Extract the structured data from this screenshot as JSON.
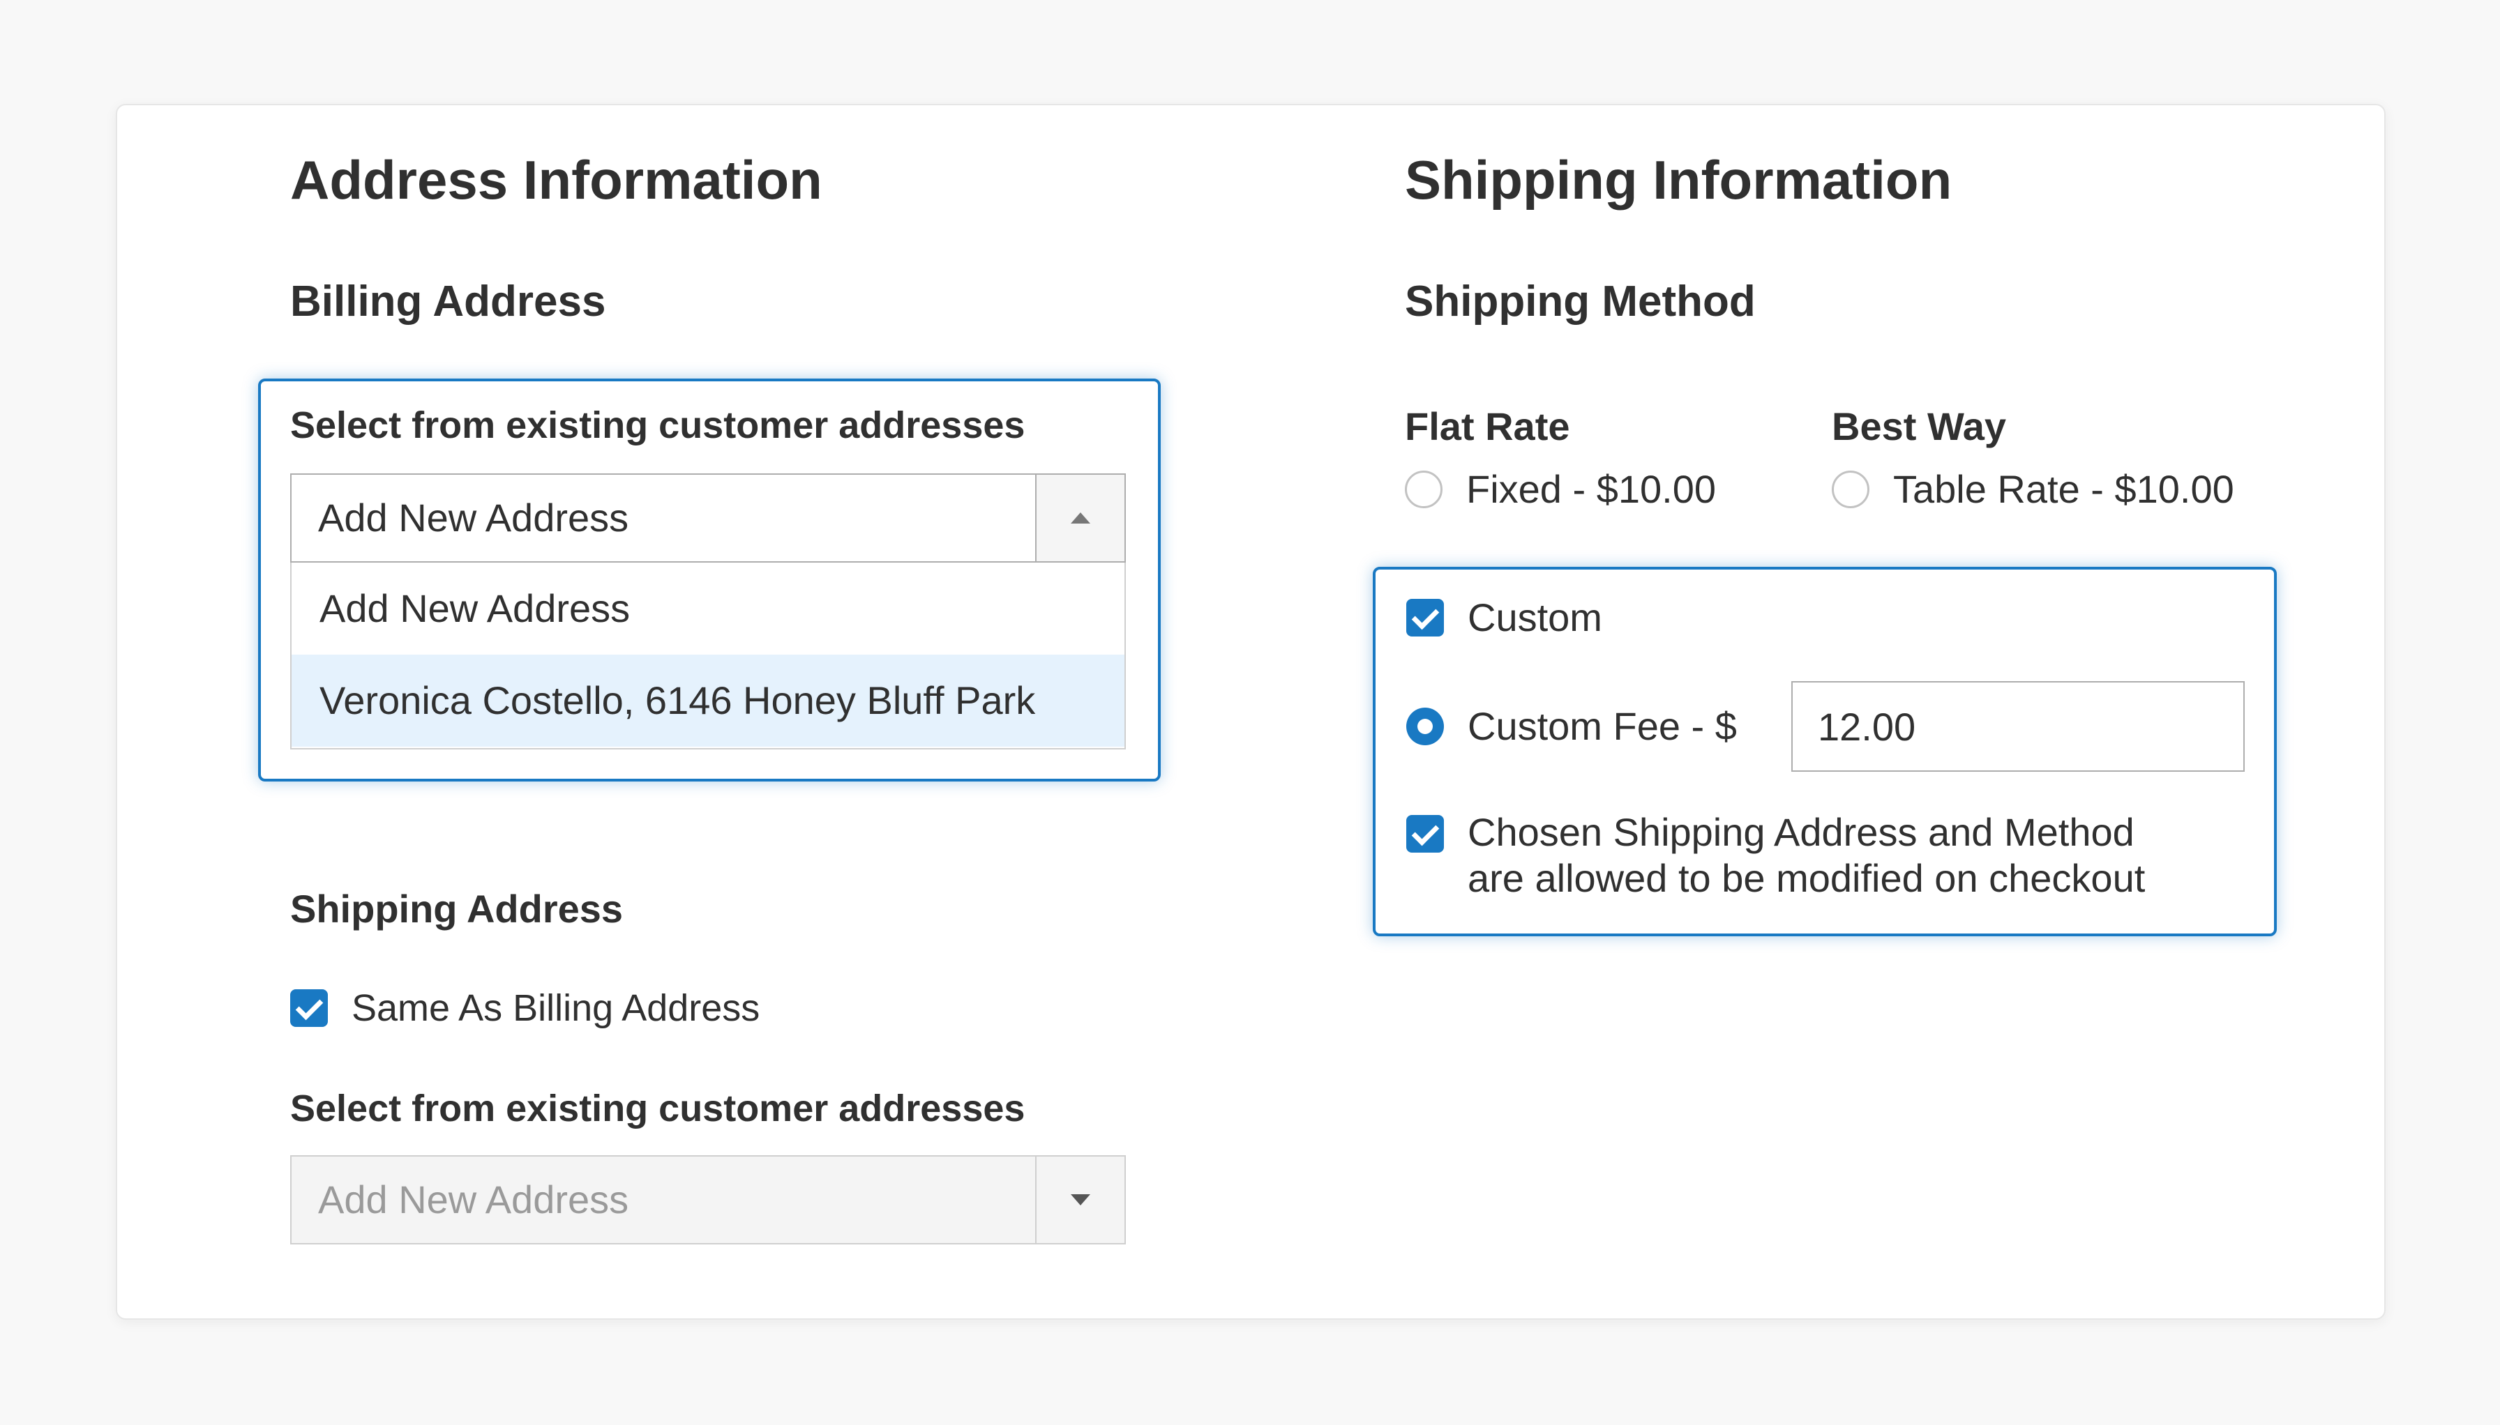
{
  "address_section": {
    "title": "Address Information",
    "billing": {
      "title": "Billing Address",
      "select_label": "Select from existing customer addresses",
      "selected_value": "Add New Address",
      "options": [
        "Add New Address",
        "Veronica Costello, 6146 Honey Bluff Park"
      ],
      "highlighted_option_index": 1
    },
    "shipping": {
      "title": "Shipping Address",
      "same_as_billing_label": "Same As Billing Address",
      "same_as_billing_checked": true,
      "select_label": "Select from existing customer addresses",
      "selected_value": "Add New Address"
    }
  },
  "shipping_section": {
    "title": "Shipping Information",
    "method_title": "Shipping Method",
    "carriers": [
      {
        "name": "Flat Rate",
        "option_label": "Fixed - $10.00",
        "selected": false
      },
      {
        "name": "Best Way",
        "option_label": "Table Rate - $10.00",
        "selected": false
      }
    ],
    "custom": {
      "label": "Custom",
      "checked": true,
      "fee_label": "Custom Fee - $",
      "fee_selected": true,
      "fee_value": "12.00",
      "modifiable_line1": "Chosen Shipping Address and Method",
      "modifiable_line2": "are allowed to be modified on checkout",
      "modifiable_checked": true
    }
  },
  "colors": {
    "accent": "#1979c3",
    "highlight": "#e5f2fd",
    "text": "#303030"
  }
}
